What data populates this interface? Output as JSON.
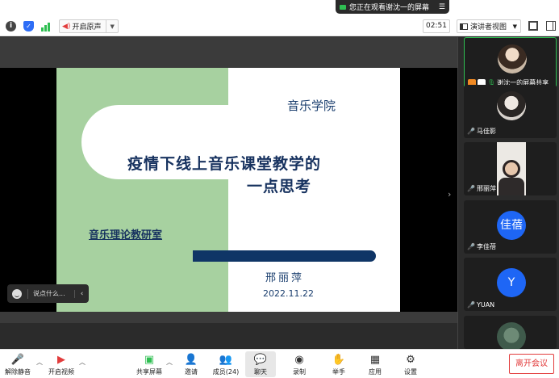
{
  "notification": {
    "viewing_text": "您正在观看谢沈一的屏幕"
  },
  "toolbar": {
    "original_sound_label": "开启原声",
    "timer": "02:51",
    "view_label": "演讲者视图"
  },
  "slide": {
    "school": "音乐学院",
    "title_line1": "疫情下线上音乐课堂教学的",
    "title_line2": "一点思考",
    "department": "音乐理论教研室",
    "author": "邢丽萍",
    "date": "2022.11.22"
  },
  "chat": {
    "placeholder": "说点什么..."
  },
  "gallery": [
    {
      "name": "谢沈一的屏幕共享",
      "type": "photo",
      "active": true
    },
    {
      "name": "马佳影",
      "type": "photo"
    },
    {
      "name": "邢丽萍",
      "type": "video"
    },
    {
      "name": "李佳蓓",
      "type": "letter",
      "letter": "佳蓓"
    },
    {
      "name": "YUAN",
      "type": "letter",
      "letter": "Y"
    }
  ],
  "bottombar": {
    "unmute": "解除静音",
    "start_video": "开启视频",
    "share_screen": "共享屏幕",
    "invite": "邀请",
    "members": "成员(24)",
    "chat": "聊天",
    "record": "录制",
    "raise_hand": "举手",
    "apps": "应用",
    "settings": "设置",
    "leave": "离开会议"
  },
  "colors": {
    "accent_blue": "#1e66f5",
    "leave_red": "#e23c3c",
    "slide_green": "#a7d1a0",
    "slide_navy": "#0f3566"
  }
}
